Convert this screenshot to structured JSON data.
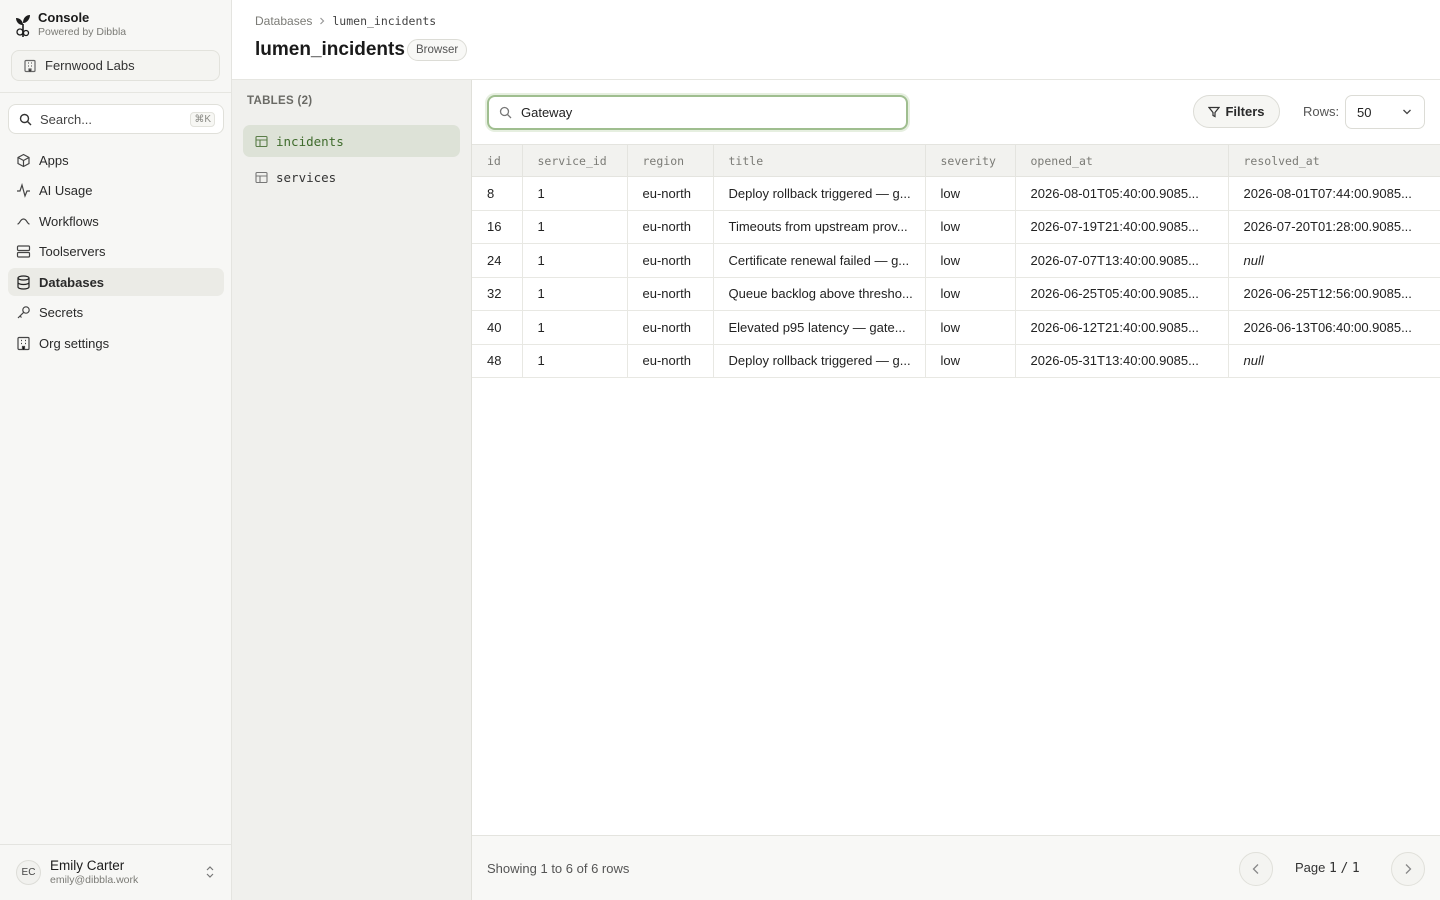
{
  "brand": {
    "title": "Console",
    "subtitle": "Powered by Dibbla"
  },
  "org": {
    "name": "Fernwood Labs"
  },
  "search": {
    "placeholder": "Search...",
    "shortcut": "⌘K"
  },
  "nav": [
    {
      "label": "Apps",
      "icon": "cube-icon",
      "active": false
    },
    {
      "label": "AI Usage",
      "icon": "activity-icon",
      "active": false
    },
    {
      "label": "Workflows",
      "icon": "workflow-icon",
      "active": false
    },
    {
      "label": "Toolservers",
      "icon": "server-icon",
      "active": false
    },
    {
      "label": "Databases",
      "icon": "database-icon",
      "active": true
    },
    {
      "label": "Secrets",
      "icon": "key-icon",
      "active": false
    },
    {
      "label": "Org settings",
      "icon": "building-icon",
      "active": false
    }
  ],
  "user": {
    "initials": "EC",
    "name": "Emily Carter",
    "email": "emily@dibbla.work"
  },
  "header": {
    "breadcrumb_root": "Databases",
    "breadcrumb_current": "lumen_incidents",
    "title": "lumen_incidents",
    "badge": "Browser"
  },
  "tables_panel": {
    "heading": "TABLES (2)",
    "items": [
      {
        "label": "incidents",
        "active": true
      },
      {
        "label": "services",
        "active": false
      }
    ]
  },
  "toolbar": {
    "filter_value": "Gateway",
    "filters_label": "Filters",
    "rows_label": "Rows:",
    "rows_value": "50"
  },
  "grid": {
    "columns": [
      "id",
      "service_id",
      "region",
      "title",
      "severity",
      "opened_at",
      "resolved_at"
    ],
    "rows": [
      [
        "8",
        "1",
        "eu-north",
        "Deploy rollback triggered — g...",
        "low",
        "2026-08-01T05:40:00.9085...",
        "2026-08-01T07:44:00.9085..."
      ],
      [
        "16",
        "1",
        "eu-north",
        "Timeouts from upstream prov...",
        "low",
        "2026-07-19T21:40:00.9085...",
        "2026-07-20T01:28:00.9085..."
      ],
      [
        "24",
        "1",
        "eu-north",
        "Certificate renewal failed — g...",
        "low",
        "2026-07-07T13:40:00.9085...",
        "null"
      ],
      [
        "32",
        "1",
        "eu-north",
        "Queue backlog above thresho...",
        "low",
        "2026-06-25T05:40:00.9085...",
        "2026-06-25T12:56:00.9085..."
      ],
      [
        "40",
        "1",
        "eu-north",
        "Elevated p95 latency — gate...",
        "low",
        "2026-06-12T21:40:00.9085...",
        "2026-06-13T06:40:00.9085..."
      ],
      [
        "48",
        "1",
        "eu-north",
        "Deploy rollback triggered — g...",
        "low",
        "2026-05-31T13:40:00.9085...",
        "null"
      ]
    ]
  },
  "footer": {
    "showing": "Showing 1 to 6 of 6 rows",
    "page_label": "Page",
    "page_current": "1",
    "page_sep": "/",
    "page_total": "1"
  },
  "colors": {
    "accent_green": "#9fbe8f",
    "active_table_bg": "#dde2d7",
    "active_table_text": "#3f6b2c"
  }
}
